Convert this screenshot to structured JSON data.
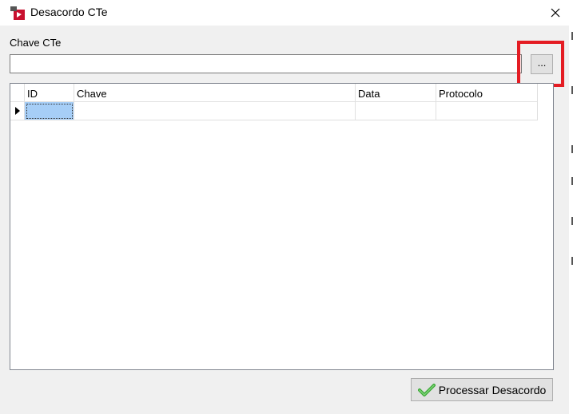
{
  "window": {
    "title": "Desacordo CTe",
    "close_icon": "close-icon"
  },
  "form": {
    "chave_label": "Chave CTe",
    "chave_value": "",
    "browse_label": "..."
  },
  "grid": {
    "columns": [
      "ID",
      "Chave",
      "Data",
      "Protocolo"
    ],
    "rows": [
      {
        "id": "",
        "chave": "",
        "data": "",
        "protocolo": ""
      }
    ]
  },
  "footer": {
    "process_label": "Processar Desacordo",
    "process_icon": "checkmark-icon"
  },
  "colors": {
    "highlight": "#e41c23",
    "selected_cell": "#a6cef7",
    "check_green": "#3aa935"
  }
}
